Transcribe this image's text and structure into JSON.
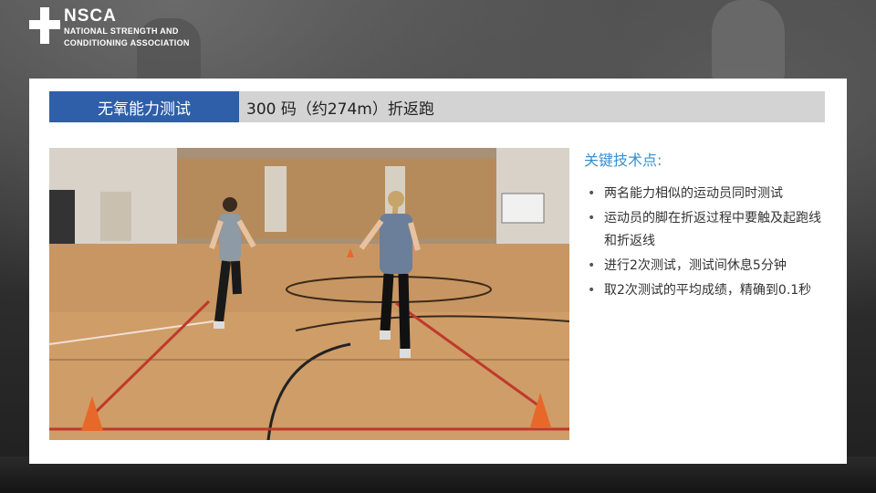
{
  "logo": {
    "brand": "NSCA",
    "line1": "NATIONAL STRENGTH AND",
    "line2": "CONDITIONING ASSOCIATION"
  },
  "slide": {
    "tag": "无氧能力测试",
    "title": "300 码（约274m）折返跑"
  },
  "key_points": {
    "heading": "关键技术点:",
    "items": [
      "两名能力相似的运动员同时测试",
      "运动员的脚在折返过程中要触及起跑线和折返线",
      "进行2次测试，测试间休息5分钟",
      "取2次测试的平均成绩，精确到0.1秒"
    ]
  },
  "colors": {
    "tag_bg": "#2e5fa8",
    "heading": "#3a8fd0"
  }
}
